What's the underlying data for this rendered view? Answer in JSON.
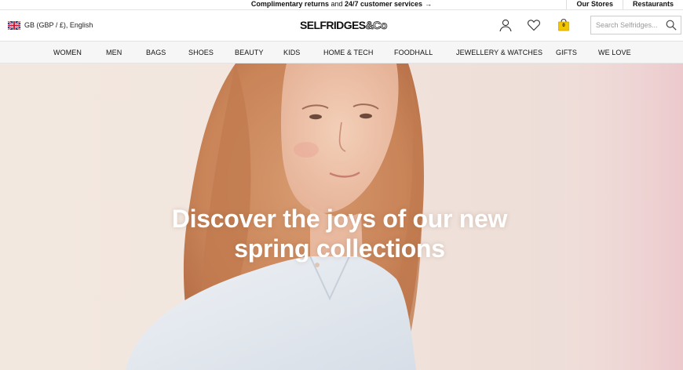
{
  "promo": {
    "text_part1": "Complimentary returns",
    "text_part2": " and ",
    "text_part3": "24/7 customer services",
    "arrow": "→"
  },
  "utility_links": [
    {
      "label": "Our Stores"
    },
    {
      "label": "Restaurants"
    }
  ],
  "locale": {
    "label": "GB (GBP / £), English",
    "flag_icon": "uk-flag-icon"
  },
  "logo": {
    "main": "SELFRIDGES",
    "suffix": "&Co"
  },
  "header_icons": {
    "account": "account-icon",
    "wishlist": "heart-icon",
    "bag": "shopping-bag-icon",
    "bag_count": "0"
  },
  "search": {
    "placeholder": "Search Selfridges...",
    "value": ""
  },
  "nav": {
    "items": [
      {
        "label": "WOMEN"
      },
      {
        "label": "MEN"
      },
      {
        "label": "BAGS"
      },
      {
        "label": "SHOES"
      },
      {
        "label": "BEAUTY"
      },
      {
        "label": "KIDS"
      },
      {
        "label": "HOME & TECH"
      },
      {
        "label": "FOODHALL"
      },
      {
        "label": "JEWELLERY & WATCHES"
      },
      {
        "label": "GIFTS"
      },
      {
        "label": "WE LOVE"
      }
    ]
  },
  "hero": {
    "heading_line1": "Discover the joys of our new",
    "heading_line2": "spring collections"
  },
  "colors": {
    "text": "#111111",
    "border": "#e3e3e3",
    "nav_bg": "#f6f6f6",
    "bag_accent": "#f2c500",
    "hero_bg": "#f3e8e0"
  }
}
